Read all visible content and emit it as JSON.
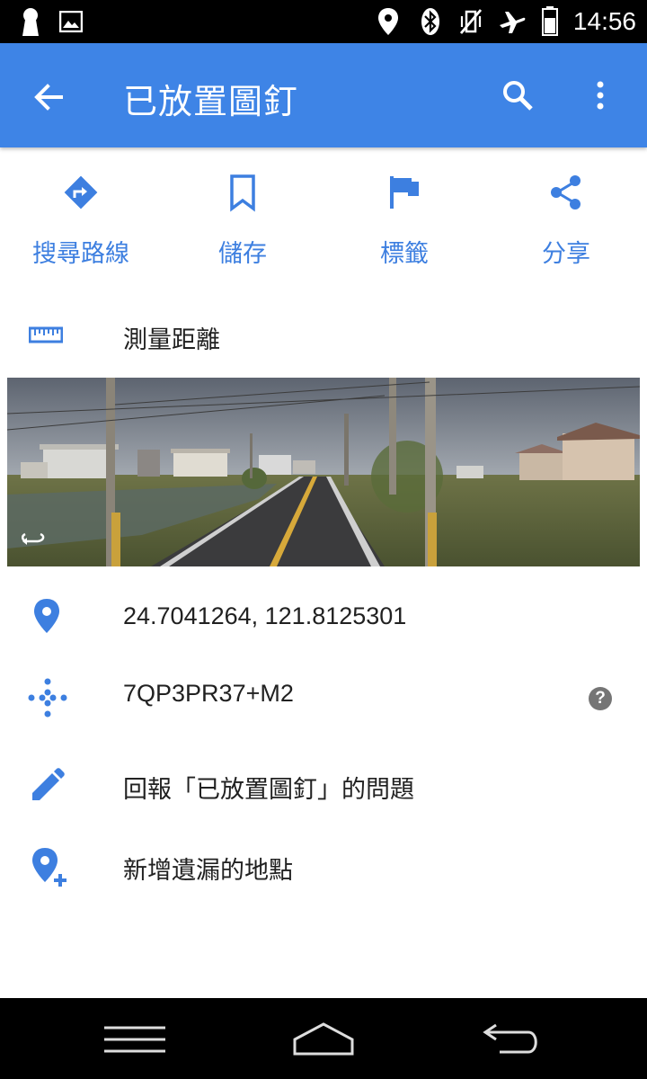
{
  "status_bar": {
    "time": "14:56",
    "icons": [
      "keyhole-icon",
      "image-icon",
      "location-icon",
      "bluetooth-icon",
      "vibrate-off-icon",
      "airplane-icon",
      "battery-icon"
    ]
  },
  "app_bar": {
    "title": "已放置圖釘",
    "color": "#3e84e6"
  },
  "actions": [
    {
      "label": "搜尋路線",
      "icon": "directions-icon"
    },
    {
      "label": "儲存",
      "icon": "bookmark-icon"
    },
    {
      "label": "標籤",
      "icon": "flag-icon"
    },
    {
      "label": "分享",
      "icon": "share-icon"
    }
  ],
  "accent_color": "#3d7fe0",
  "measure": {
    "label": "測量距離",
    "icon": "ruler-icon"
  },
  "street_view": {
    "icon": "rotate-360-icon"
  },
  "details": {
    "coordinates": "24.7041264, 121.8125301",
    "plus_code": "7QP3PR37+M2",
    "report": "回報「已放置圖釘」的問題",
    "add_place": "新增遺漏的地點"
  },
  "nav_bar": {
    "icons": [
      "recent-apps-icon",
      "home-icon",
      "back-icon"
    ]
  }
}
